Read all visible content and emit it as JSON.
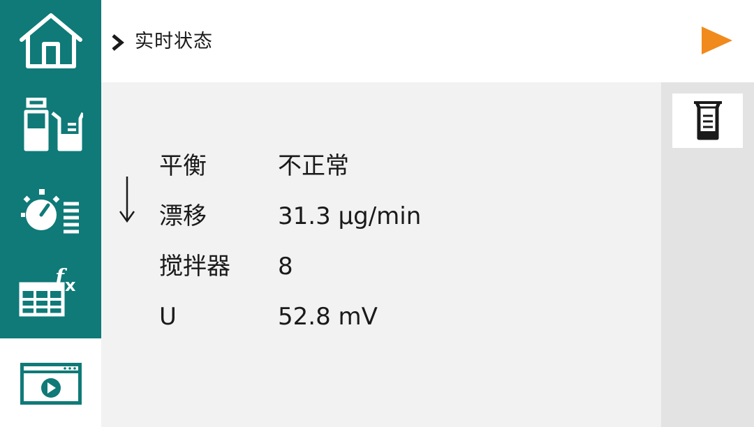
{
  "theme": {
    "teal": "#0f7a78",
    "accent_orange": "#f08a1c",
    "content_bg": "#f2f2f2",
    "side_panel_bg": "#e3e3e3"
  },
  "sidebar": {
    "items": [
      {
        "name": "home",
        "icon": "home-icon",
        "active": false
      },
      {
        "name": "samples",
        "icon": "bottle-beaker-icon",
        "active": false
      },
      {
        "name": "settings",
        "icon": "timer-list-icon",
        "active": false
      },
      {
        "name": "formulas",
        "icon": "table-function-icon",
        "active": false
      },
      {
        "name": "live",
        "icon": "live-window-play-icon",
        "active": true
      }
    ]
  },
  "header": {
    "breadcrumb_icon": "chevron-right-icon",
    "title": "实时状态",
    "start_icon": "play-icon"
  },
  "status": {
    "trend_icon": "down-arrow-icon",
    "rows": [
      {
        "label": "平衡",
        "value": "不正常"
      },
      {
        "label": "漂移",
        "value": "31.3 µg/min"
      },
      {
        "label": "搅拌器",
        "value": "8"
      },
      {
        "label": "U",
        "value": "52.8 mV"
      }
    ]
  },
  "side_panel": {
    "button_icon": "beaker-icon"
  }
}
